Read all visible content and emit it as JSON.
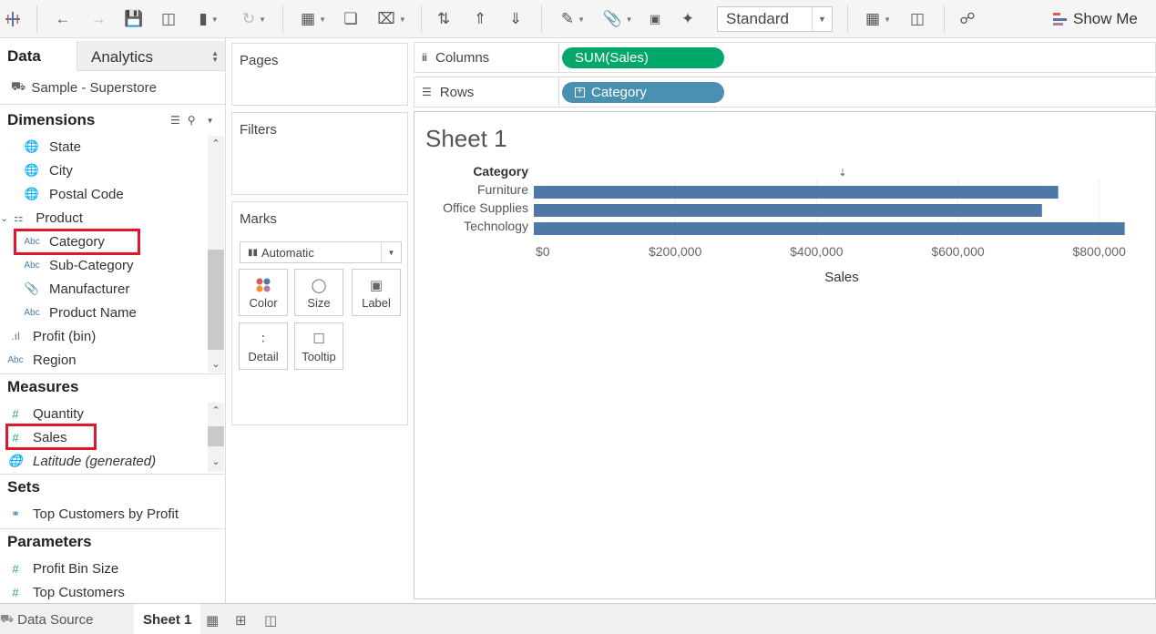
{
  "toolbar": {
    "standard_label": "Standard",
    "show_me_label": "Show Me",
    "show_me_colors": [
      "#e15759",
      "#4e79a7",
      "#b07aa1"
    ]
  },
  "data_pane": {
    "tab_data": "Data",
    "tab_analytics": "Analytics",
    "source": "Sample - Superstore",
    "dimensions_title": "Dimensions",
    "dimensions": [
      {
        "label": "State",
        "icon": "globe-icon"
      },
      {
        "label": "City",
        "icon": "globe-icon"
      },
      {
        "label": "Postal Code",
        "icon": "globe-icon"
      },
      {
        "label": "Product",
        "icon": "hierarchy-icon"
      },
      {
        "label": "Category",
        "icon": "abc-icon"
      },
      {
        "label": "Sub-Category",
        "icon": "abc-icon"
      },
      {
        "label": "Manufacturer",
        "icon": "paperclip-icon"
      },
      {
        "label": "Product Name",
        "icon": "abc-icon"
      },
      {
        "label": "Profit (bin)",
        "icon": "histogram-icon"
      },
      {
        "label": "Region",
        "icon": "abc-icon"
      }
    ],
    "measures_title": "Measures",
    "measures": [
      {
        "label": "Quantity",
        "icon": "hash-icon"
      },
      {
        "label": "Sales",
        "icon": "hash-icon"
      },
      {
        "label": "Latitude (generated)",
        "icon": "globe-icon"
      }
    ],
    "sets_title": "Sets",
    "sets": [
      {
        "label": "Top Customers by Profit",
        "icon": "set-icon"
      }
    ],
    "parameters_title": "Parameters",
    "parameters": [
      {
        "label": "Profit Bin Size",
        "icon": "hash-icon"
      },
      {
        "label": "Top Customers",
        "icon": "hash-icon"
      }
    ],
    "highlight_color": "#e0162b"
  },
  "shelves": {
    "pages": "Pages",
    "filters": "Filters",
    "marks": "Marks",
    "mark_type": "Automatic",
    "mark_buttons": [
      "Color",
      "Size",
      "Label",
      "Detail",
      "Tooltip"
    ],
    "columns_label": "Columns",
    "rows_label": "Rows",
    "columns_pill": "SUM(Sales)",
    "rows_pill": "Category",
    "columns_pill_color": "#02a86a",
    "rows_pill_color": "#4a90b0"
  },
  "view": {
    "sheet_title": "Sheet 1"
  },
  "chart_data": {
    "type": "bar",
    "orientation": "horizontal",
    "categories": [
      "Furniture",
      "Office Supplies",
      "Technology"
    ],
    "values": [
      742000,
      719000,
      836000
    ],
    "row_header": "Category",
    "xlabel": "Sales",
    "xlim": [
      0,
      870000
    ],
    "xticks": [
      0,
      200000,
      400000,
      600000,
      800000
    ],
    "xtick_labels": [
      "$0",
      "$200,000",
      "$400,000",
      "$600,000",
      "$800,000"
    ],
    "bar_color": "#4e79a7",
    "grid": true
  },
  "bottom_tabs": {
    "data_source": "Data Source",
    "sheet": "Sheet 1"
  }
}
